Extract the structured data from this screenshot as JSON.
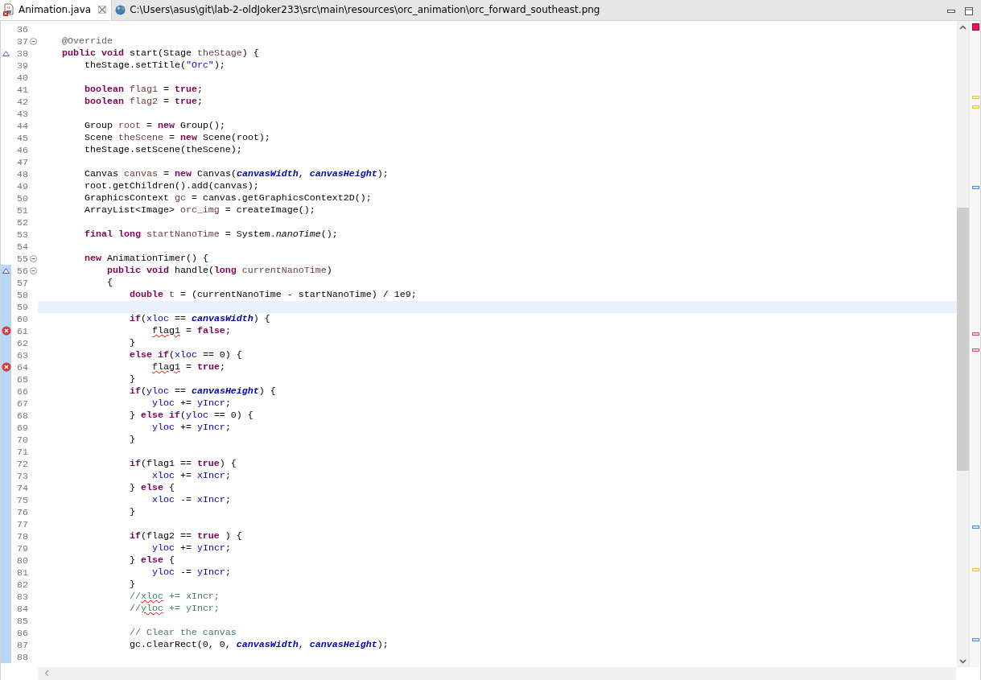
{
  "tabs": [
    {
      "label": "Animation.java",
      "selected": true,
      "closable": true
    },
    {
      "label": "C:\\Users\\asus\\git\\lab-2-oldJoker233\\src\\main\\resources\\orc_animation\\orc_forward_southeast.png",
      "selected": false,
      "closable": false
    }
  ],
  "editor": {
    "lines": [
      {
        "number": "36",
        "changed": false,
        "current": false
      },
      {
        "number": "37",
        "expanded": true,
        "changed": false,
        "current": false,
        "tokens": [
          {
            "kind": "annotation",
            "text": "    @Override"
          }
        ]
      },
      {
        "number": "38",
        "override": true,
        "changed": false,
        "current": false,
        "tokens": [
          {
            "kind": "keyword",
            "text": "    public void"
          },
          {
            "kind": "plain",
            "text": " start(Stage "
          },
          {
            "kind": "local",
            "text": "theStage"
          },
          {
            "kind": "plain",
            "text": ") {"
          }
        ]
      },
      {
        "number": "39",
        "changed": false,
        "current": false,
        "tokens": [
          {
            "kind": "plain",
            "text": "        theStage.setTitle("
          },
          {
            "kind": "string",
            "text": "\"Orc\""
          },
          {
            "kind": "plain",
            "text": ");"
          }
        ]
      },
      {
        "number": "40",
        "changed": false,
        "current": false
      },
      {
        "number": "41",
        "changed": false,
        "current": false,
        "tokens": [
          {
            "kind": "keyword",
            "text": "        boolean "
          },
          {
            "kind": "local",
            "text": "flag1"
          },
          {
            "kind": "plain",
            "text": " = "
          },
          {
            "kind": "keyword",
            "text": "true"
          },
          {
            "kind": "plain",
            "text": ";"
          }
        ]
      },
      {
        "number": "42",
        "changed": false,
        "current": false,
        "tokens": [
          {
            "kind": "keyword",
            "text": "        boolean "
          },
          {
            "kind": "local",
            "text": "flag2"
          },
          {
            "kind": "plain",
            "text": " = "
          },
          {
            "kind": "keyword",
            "text": "true"
          },
          {
            "kind": "plain",
            "text": ";"
          }
        ]
      },
      {
        "number": "43",
        "changed": false,
        "current": false
      },
      {
        "number": "44",
        "changed": false,
        "current": false,
        "tokens": [
          {
            "kind": "plain",
            "text": "        Group "
          },
          {
            "kind": "local",
            "text": "root"
          },
          {
            "kind": "plain",
            "text": " = "
          },
          {
            "kind": "keyword",
            "text": "new"
          },
          {
            "kind": "plain",
            "text": " Group();"
          }
        ]
      },
      {
        "number": "45",
        "changed": false,
        "current": false,
        "tokens": [
          {
            "kind": "plain",
            "text": "        Scene "
          },
          {
            "kind": "local",
            "text": "theScene"
          },
          {
            "kind": "plain",
            "text": " = "
          },
          {
            "kind": "keyword",
            "text": "new"
          },
          {
            "kind": "plain",
            "text": " Scene(root);"
          }
        ]
      },
      {
        "number": "46",
        "changed": false,
        "current": false,
        "tokens": [
          {
            "kind": "plain",
            "text": "        theStage.setScene(theScene);"
          }
        ]
      },
      {
        "number": "47",
        "changed": false,
        "current": false
      },
      {
        "number": "48",
        "changed": false,
        "current": false,
        "tokens": [
          {
            "kind": "plain",
            "text": "        Canvas "
          },
          {
            "kind": "local",
            "text": "canvas"
          },
          {
            "kind": "plain",
            "text": " = "
          },
          {
            "kind": "keyword",
            "text": "new"
          },
          {
            "kind": "plain",
            "text": " Canvas("
          },
          {
            "kind": "static",
            "text": "canvasWidth"
          },
          {
            "kind": "plain",
            "text": ", "
          },
          {
            "kind": "static",
            "text": "canvasHeight"
          },
          {
            "kind": "plain",
            "text": ");"
          }
        ]
      },
      {
        "number": "49",
        "changed": false,
        "current": false,
        "tokens": [
          {
            "kind": "plain",
            "text": "        root.getChildren().add(canvas);"
          }
        ]
      },
      {
        "number": "50",
        "changed": false,
        "current": false,
        "tokens": [
          {
            "kind": "plain",
            "text": "        GraphicsContext "
          },
          {
            "kind": "local",
            "text": "gc"
          },
          {
            "kind": "plain",
            "text": " = canvas.getGraphicsContext2D();"
          }
        ]
      },
      {
        "number": "51",
        "changed": false,
        "current": false,
        "tokens": [
          {
            "kind": "plain",
            "text": "        ArrayList<Image> "
          },
          {
            "kind": "local",
            "text": "orc_img"
          },
          {
            "kind": "plain",
            "text": " = createImage();"
          }
        ]
      },
      {
        "number": "52",
        "changed": false,
        "current": false
      },
      {
        "number": "53",
        "changed": false,
        "current": false,
        "tokens": [
          {
            "kind": "keyword",
            "text": "        final long "
          },
          {
            "kind": "local",
            "text": "startNanoTime"
          },
          {
            "kind": "plain",
            "text": " = System."
          },
          {
            "kind": "static-method",
            "text": "nanoTime"
          },
          {
            "kind": "plain",
            "text": "();"
          }
        ]
      },
      {
        "number": "54",
        "changed": false,
        "current": false
      },
      {
        "number": "55",
        "expanded": true,
        "changed": false,
        "current": false,
        "tokens": [
          {
            "kind": "keyword",
            "text": "        new"
          },
          {
            "kind": "plain",
            "text": " AnimationTimer() {"
          }
        ]
      },
      {
        "number": "56",
        "expanded": true,
        "override": true,
        "changed": true,
        "current": false,
        "tokens": [
          {
            "kind": "keyword",
            "text": "            public void"
          },
          {
            "kind": "plain",
            "text": " handle("
          },
          {
            "kind": "keyword",
            "text": "long "
          },
          {
            "kind": "local",
            "text": "currentNanoTime"
          },
          {
            "kind": "plain",
            "text": ")"
          }
        ]
      },
      {
        "number": "57",
        "changed": true,
        "current": false,
        "tokens": [
          {
            "kind": "plain",
            "text": "            {"
          }
        ]
      },
      {
        "number": "58",
        "changed": true,
        "current": false,
        "tokens": [
          {
            "kind": "keyword",
            "text": "                double "
          },
          {
            "kind": "local",
            "text": "t"
          },
          {
            "kind": "plain",
            "text": " = (currentNanoTime - startNanoTime) / 1e9;"
          }
        ]
      },
      {
        "number": "59",
        "changed": true,
        "current": true
      },
      {
        "number": "60",
        "changed": true,
        "current": false,
        "tokens": [
          {
            "kind": "keyword",
            "text": "                if"
          },
          {
            "kind": "plain",
            "text": "("
          },
          {
            "kind": "field",
            "text": "xloc"
          },
          {
            "kind": "plain",
            "text": " == "
          },
          {
            "kind": "static",
            "text": "canvasWidth"
          },
          {
            "kind": "plain",
            "text": ") {"
          }
        ]
      },
      {
        "number": "61",
        "error": true,
        "changed": true,
        "current": false,
        "tokens": [
          {
            "kind": "error",
            "text": "                    flag1"
          },
          {
            "kind": "plain",
            "text": " = "
          },
          {
            "kind": "keyword",
            "text": "false"
          },
          {
            "kind": "plain",
            "text": ";"
          }
        ]
      },
      {
        "number": "62",
        "changed": true,
        "current": false,
        "tokens": [
          {
            "kind": "plain",
            "text": "                }"
          }
        ]
      },
      {
        "number": "63",
        "changed": true,
        "current": false,
        "tokens": [
          {
            "kind": "keyword",
            "text": "                else if"
          },
          {
            "kind": "plain",
            "text": "("
          },
          {
            "kind": "field",
            "text": "xloc"
          },
          {
            "kind": "plain",
            "text": " == 0) {"
          }
        ]
      },
      {
        "number": "64",
        "error": true,
        "changed": true,
        "current": false,
        "tokens": [
          {
            "kind": "error",
            "text": "                    flag1"
          },
          {
            "kind": "plain",
            "text": " = "
          },
          {
            "kind": "keyword",
            "text": "true"
          },
          {
            "kind": "plain",
            "text": ";"
          }
        ]
      },
      {
        "number": "65",
        "changed": true,
        "current": false,
        "tokens": [
          {
            "kind": "plain",
            "text": "                }"
          }
        ]
      },
      {
        "number": "66",
        "changed": true,
        "current": false,
        "tokens": [
          {
            "kind": "keyword",
            "text": "                if"
          },
          {
            "kind": "plain",
            "text": "("
          },
          {
            "kind": "field",
            "text": "yloc"
          },
          {
            "kind": "plain",
            "text": " == "
          },
          {
            "kind": "static",
            "text": "canvasHeight"
          },
          {
            "kind": "plain",
            "text": ") {"
          }
        ]
      },
      {
        "number": "67",
        "changed": true,
        "current": false,
        "tokens": [
          {
            "kind": "field",
            "text": "                    yloc"
          },
          {
            "kind": "plain",
            "text": " += "
          },
          {
            "kind": "field",
            "text": "yIncr"
          },
          {
            "kind": "plain",
            "text": ";"
          }
        ]
      },
      {
        "number": "68",
        "changed": true,
        "current": false,
        "tokens": [
          {
            "kind": "plain",
            "text": "                } "
          },
          {
            "kind": "keyword",
            "text": "else if"
          },
          {
            "kind": "plain",
            "text": "("
          },
          {
            "kind": "field",
            "text": "yloc"
          },
          {
            "kind": "plain",
            "text": " == 0) {"
          }
        ]
      },
      {
        "number": "69",
        "changed": true,
        "current": false,
        "tokens": [
          {
            "kind": "field",
            "text": "                    yloc"
          },
          {
            "kind": "plain",
            "text": " += "
          },
          {
            "kind": "field",
            "text": "yIncr"
          },
          {
            "kind": "plain",
            "text": ";"
          }
        ]
      },
      {
        "number": "70",
        "changed": true,
        "current": false,
        "tokens": [
          {
            "kind": "plain",
            "text": "                }"
          }
        ]
      },
      {
        "number": "71",
        "changed": true,
        "current": false
      },
      {
        "number": "72",
        "changed": true,
        "current": false,
        "tokens": [
          {
            "kind": "keyword",
            "text": "                if"
          },
          {
            "kind": "plain",
            "text": "(flag1 == "
          },
          {
            "kind": "keyword",
            "text": "true"
          },
          {
            "kind": "plain",
            "text": ") {"
          }
        ]
      },
      {
        "number": "73",
        "changed": true,
        "current": false,
        "tokens": [
          {
            "kind": "field",
            "text": "                    xloc"
          },
          {
            "kind": "plain",
            "text": " += "
          },
          {
            "kind": "field",
            "text": "xIncr"
          },
          {
            "kind": "plain",
            "text": ";"
          }
        ]
      },
      {
        "number": "74",
        "changed": true,
        "current": false,
        "tokens": [
          {
            "kind": "plain",
            "text": "                } "
          },
          {
            "kind": "keyword",
            "text": "else"
          },
          {
            "kind": "plain",
            "text": " {"
          }
        ]
      },
      {
        "number": "75",
        "changed": true,
        "current": false,
        "tokens": [
          {
            "kind": "field",
            "text": "                    xloc"
          },
          {
            "kind": "plain",
            "text": " -= "
          },
          {
            "kind": "field",
            "text": "xIncr"
          },
          {
            "kind": "plain",
            "text": ";"
          }
        ]
      },
      {
        "number": "76",
        "changed": true,
        "current": false,
        "tokens": [
          {
            "kind": "plain",
            "text": "                }"
          }
        ]
      },
      {
        "number": "77",
        "changed": true,
        "current": false
      },
      {
        "number": "78",
        "changed": true,
        "current": false,
        "tokens": [
          {
            "kind": "keyword",
            "text": "                if"
          },
          {
            "kind": "plain",
            "text": "(flag2 == "
          },
          {
            "kind": "keyword",
            "text": "true"
          },
          {
            "kind": "plain",
            "text": " ) {"
          }
        ]
      },
      {
        "number": "79",
        "changed": true,
        "current": false,
        "tokens": [
          {
            "kind": "field",
            "text": "                    yloc"
          },
          {
            "kind": "plain",
            "text": " += "
          },
          {
            "kind": "field",
            "text": "yIncr"
          },
          {
            "kind": "plain",
            "text": ";"
          }
        ]
      },
      {
        "number": "80",
        "changed": true,
        "current": false,
        "tokens": [
          {
            "kind": "plain",
            "text": "                } "
          },
          {
            "kind": "keyword",
            "text": "else"
          },
          {
            "kind": "plain",
            "text": " {"
          }
        ]
      },
      {
        "number": "81",
        "changed": true,
        "current": false,
        "tokens": [
          {
            "kind": "field",
            "text": "                    yloc"
          },
          {
            "kind": "plain",
            "text": " -= "
          },
          {
            "kind": "field",
            "text": "yIncr"
          },
          {
            "kind": "plain",
            "text": ";"
          }
        ]
      },
      {
        "number": "82",
        "changed": true,
        "current": false,
        "tokens": [
          {
            "kind": "plain",
            "text": "                }"
          }
        ]
      },
      {
        "number": "83",
        "changed": true,
        "current": false,
        "tokens": [
          {
            "kind": "comment",
            "text": "                //"
          },
          {
            "kind": "comment-misspelled",
            "text": "xloc"
          },
          {
            "kind": "comment",
            "text": " += xIncr;"
          }
        ]
      },
      {
        "number": "84",
        "changed": true,
        "current": false,
        "tokens": [
          {
            "kind": "comment",
            "text": "                //"
          },
          {
            "kind": "comment-misspelled",
            "text": "yloc"
          },
          {
            "kind": "comment",
            "text": " += yIncr;"
          }
        ]
      },
      {
        "number": "85",
        "changed": true,
        "current": false
      },
      {
        "number": "86",
        "changed": true,
        "current": false,
        "tokens": [
          {
            "kind": "comment",
            "text": "                // Clear the canvas"
          }
        ]
      },
      {
        "number": "87",
        "changed": true,
        "current": false,
        "tokens": [
          {
            "kind": "plain",
            "text": "                gc.clearRect(0, 0, "
          },
          {
            "kind": "static",
            "text": "canvasWidth"
          },
          {
            "kind": "plain",
            "text": ", "
          },
          {
            "kind": "static",
            "text": "canvasHeight"
          },
          {
            "kind": "plain",
            "text": ");"
          }
        ]
      },
      {
        "number": "88",
        "changed": true,
        "current": false
      }
    ],
    "overview_marks": [
      {
        "kind": "error-summary"
      },
      {
        "kind": "warning"
      },
      {
        "kind": "warning"
      },
      {
        "kind": "occurrence"
      },
      {
        "kind": "error"
      },
      {
        "kind": "error"
      },
      {
        "kind": "occurrence"
      },
      {
        "kind": "warning"
      },
      {
        "kind": "occurrence"
      }
    ]
  }
}
